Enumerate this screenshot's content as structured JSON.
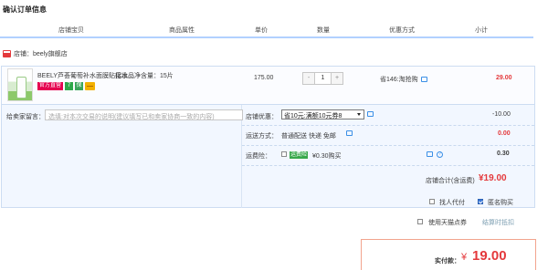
{
  "page": {
    "title": "确认订单信息"
  },
  "header": {
    "shop_col": "店铺宝贝",
    "props_col": "商品属性",
    "price_col": "单价",
    "qty_col": "数量",
    "promo_col": "优惠方式",
    "subtotal_col": "小计"
  },
  "shop": {
    "label": "店铺：beely旗舰店"
  },
  "item": {
    "name": "BEELY芦荟葡萄补水面膜贴接水...",
    "props": "化妆品净含量：15片",
    "badge_official": "官方直营",
    "badge_seven": "7",
    "badge_guarantee": "保",
    "price": "175.00",
    "quantity": "1",
    "minus": "-",
    "plus": "+",
    "promo": "省146:淘抢购",
    "subtotal": "29.00"
  },
  "message": {
    "label": "给卖家留言：",
    "placeholder": "选填:对本次交易的说明(建议填写已和卖家协商一致的内容)"
  },
  "shop_promo": {
    "label": "店铺优惠：",
    "selected": "省10元:满额10元券8",
    "value": "-10.00"
  },
  "shipping": {
    "label": "运送方式：",
    "value": "普通配送 快递 免邮",
    "amount": "0.00"
  },
  "insurance": {
    "label": "运费险：",
    "badge": "运费险",
    "text": "¥0.30购买",
    "amount": "0.30"
  },
  "shop_total": {
    "label": "店铺合计(含运费)",
    "value": "¥19.00"
  },
  "options": {
    "proxy_pay": "找人代付",
    "anonymous": "匿名购买",
    "tmall_points": "使用天猫点券",
    "points_link": "结算时抵扣"
  },
  "final": {
    "label": "实付款：",
    "currency": "¥",
    "amount": "19.00"
  },
  "colors": {
    "accent_red": "#e4393c",
    "header_border": "#b2d1ff",
    "promo_bg": "#f2f7ff"
  }
}
